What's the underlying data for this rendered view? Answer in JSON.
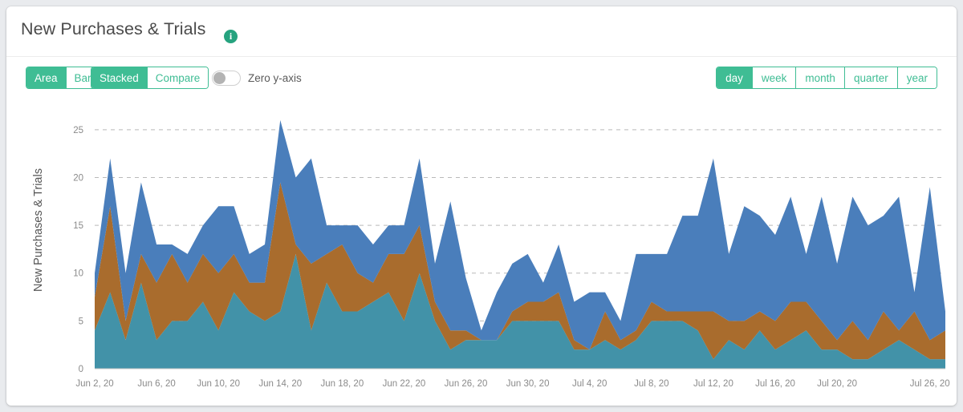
{
  "header": {
    "title": "New Purchases & Trials",
    "info_icon": "info-icon",
    "info_glyph": "i"
  },
  "toolbar": {
    "chart_type": {
      "options": [
        "Area",
        "Bar"
      ],
      "selected": "Area"
    },
    "stack_mode": {
      "options": [
        "Stacked",
        "Compare"
      ],
      "selected": "Stacked"
    },
    "zero_y_axis": {
      "label": "Zero y-axis",
      "enabled": false
    },
    "granularity": {
      "options": [
        "day",
        "week",
        "month",
        "quarter",
        "year"
      ],
      "selected": "day"
    }
  },
  "colors": {
    "accent": "#3fbd94",
    "info_badge": "#26a37f",
    "series_teal": "#4292a8",
    "series_brown": "#a96c2d",
    "series_blue": "#4a7ebb",
    "gridline": "#b9b9b9",
    "axis_text": "#8a8a8a"
  },
  "chart_data": {
    "type": "area",
    "stacked": true,
    "title": "New Purchases & Trials",
    "xlabel": "",
    "ylabel": "New Purchases & Trials",
    "ylim": [
      0,
      27
    ],
    "yticks": [
      0,
      5,
      10,
      15,
      20,
      25
    ],
    "ytick_labels": [
      "0",
      "5",
      "10",
      "15",
      "20",
      "25"
    ],
    "grid": true,
    "grid_style": "dashed-horizontal",
    "legend": "none",
    "x": [
      "Jun 2, 20",
      "Jun 3, 20",
      "Jun 4, 20",
      "Jun 5, 20",
      "Jun 6, 20",
      "Jun 7, 20",
      "Jun 8, 20",
      "Jun 9, 20",
      "Jun 10, 20",
      "Jun 11, 20",
      "Jun 12, 20",
      "Jun 13, 20",
      "Jun 14, 20",
      "Jun 15, 20",
      "Jun 16, 20",
      "Jun 17, 20",
      "Jun 18, 20",
      "Jun 19, 20",
      "Jun 20, 20",
      "Jun 21, 20",
      "Jun 22, 20",
      "Jun 23, 20",
      "Jun 24, 20",
      "Jun 25, 20",
      "Jun 26, 20",
      "Jun 27, 20",
      "Jun 28, 20",
      "Jun 29, 20",
      "Jun 30, 20",
      "Jul 1, 20",
      "Jul 2, 20",
      "Jul 3, 20",
      "Jul 4, 20",
      "Jul 5, 20",
      "Jul 6, 20",
      "Jul 7, 20",
      "Jul 8, 20",
      "Jul 9, 20",
      "Jul 10, 20",
      "Jul 11, 20",
      "Jul 12, 20",
      "Jul 13, 20",
      "Jul 14, 20",
      "Jul 15, 20",
      "Jul 16, 20",
      "Jul 17, 20",
      "Jul 18, 20",
      "Jul 19, 20",
      "Jul 20, 20",
      "Jul 21, 20",
      "Jul 22, 20",
      "Jul 23, 20",
      "Jul 24, 20",
      "Jul 25, 20",
      "Jul 26, 20",
      "Jul 27, 20"
    ],
    "xtick_labels": [
      "Jun 2, 20",
      "Jun 6, 20",
      "Jun 10, 20",
      "Jun 14, 20",
      "Jun 18, 20",
      "Jun 22, 20",
      "Jun 26, 20",
      "Jun 30, 20",
      "Jul 4, 20",
      "Jul 8, 20",
      "Jul 12, 20",
      "Jul 16, 20",
      "Jul 20, 20",
      "Jul 26, 20"
    ],
    "xtick_indices": [
      0,
      4,
      8,
      12,
      16,
      20,
      24,
      28,
      32,
      36,
      40,
      44,
      48,
      54
    ],
    "series": [
      {
        "name": "series-teal",
        "color": "#4292a8",
        "values": [
          4,
          8,
          3,
          9,
          3,
          5,
          5,
          7,
          4,
          8,
          6,
          5,
          6,
          12,
          4,
          9,
          6,
          6,
          7,
          8,
          5,
          10,
          5,
          2,
          3,
          3,
          3,
          5,
          5,
          5,
          5,
          2,
          2,
          3,
          2,
          3,
          5,
          5,
          5,
          4,
          1,
          3,
          2,
          4,
          2,
          3,
          4,
          2,
          2,
          1,
          1,
          2,
          3,
          2,
          1,
          1
        ]
      },
      {
        "name": "series-brown",
        "color": "#a96c2d",
        "values": [
          3.5,
          9,
          2,
          3,
          6,
          7,
          4,
          5,
          6,
          4,
          3,
          4,
          13.5,
          1,
          7,
          3,
          7,
          4,
          2,
          4,
          7,
          5,
          2,
          2,
          1,
          0,
          0,
          1,
          2,
          2,
          3,
          1,
          0,
          3,
          1,
          1,
          2,
          1,
          1,
          2,
          5,
          2,
          3,
          2,
          3,
          4,
          3,
          3,
          1,
          4,
          2,
          4,
          1,
          4,
          2,
          3
        ]
      },
      {
        "name": "series-blue",
        "color": "#4a7ebb",
        "values": [
          2.5,
          5,
          5,
          7.5,
          4,
          1,
          3,
          3,
          7,
          5,
          3,
          4,
          6.5,
          7,
          11,
          3,
          2,
          5,
          4,
          3,
          3,
          7,
          4,
          13.5,
          5.5,
          1,
          5,
          5,
          5,
          2,
          5,
          4,
          6,
          2,
          2,
          8,
          5,
          6,
          10,
          10,
          16,
          7,
          12,
          10,
          9,
          11,
          5,
          13,
          8,
          13,
          12,
          10,
          14,
          2,
          16,
          2
        ]
      }
    ]
  }
}
